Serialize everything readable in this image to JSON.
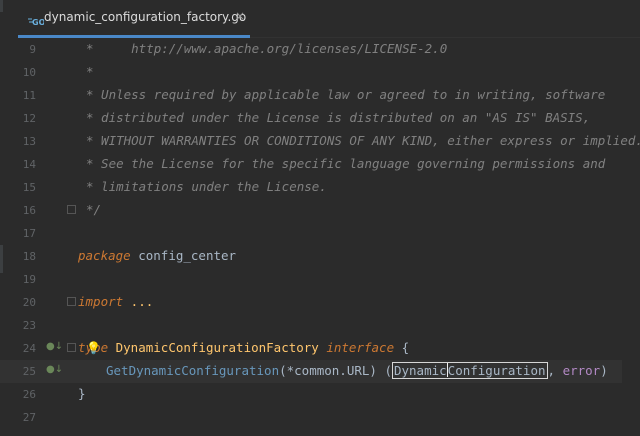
{
  "tab": {
    "label": "dynamic_configuration_factory.go",
    "close": "×",
    "icon": "go-file-icon"
  },
  "lines": [
    {
      "n": "9",
      "text": "*     http://www.apache.org/licenses/LICENSE-2.0"
    },
    {
      "n": "10",
      "text": "*"
    },
    {
      "n": "11",
      "text": "* Unless required by applicable law or agreed to in writing, software"
    },
    {
      "n": "12",
      "text": "* distributed under the License is distributed on an \"AS IS\" BASIS,"
    },
    {
      "n": "13",
      "text": "* WITHOUT WARRANTIES OR CONDITIONS OF ANY KIND, either express or implied."
    },
    {
      "n": "14",
      "text": "* See the License for the specific language governing permissions and"
    },
    {
      "n": "15",
      "text": "* limitations under the License."
    },
    {
      "n": "16",
      "text": "*/"
    },
    {
      "n": "17",
      "text": ""
    },
    {
      "n": "18",
      "kw": "package",
      "rest": " config_center"
    },
    {
      "n": "19",
      "text": ""
    },
    {
      "n": "20",
      "kw": "import",
      "rest": " ..."
    },
    {
      "n": "23",
      "text": ""
    },
    {
      "n": "24",
      "kw": "type",
      "type": " DynamicConfigurationFactory ",
      "iface": "interface",
      "rest": " {"
    },
    {
      "n": "25",
      "fn": "GetDynamicConfiguration",
      "args": "(*common.URL) (",
      "sel_a": "Dynamic",
      "sel_b": "Configuration",
      "tail_sep": ", ",
      "err": "error",
      "close": ")"
    },
    {
      "n": "26",
      "text": "}"
    },
    {
      "n": "27",
      "text": ""
    }
  ],
  "colors": {
    "background": "#2b2b2b",
    "comment": "#808080",
    "keyword": "#cc7832",
    "type": "#ffc66d",
    "accent": "#4a88c7"
  }
}
